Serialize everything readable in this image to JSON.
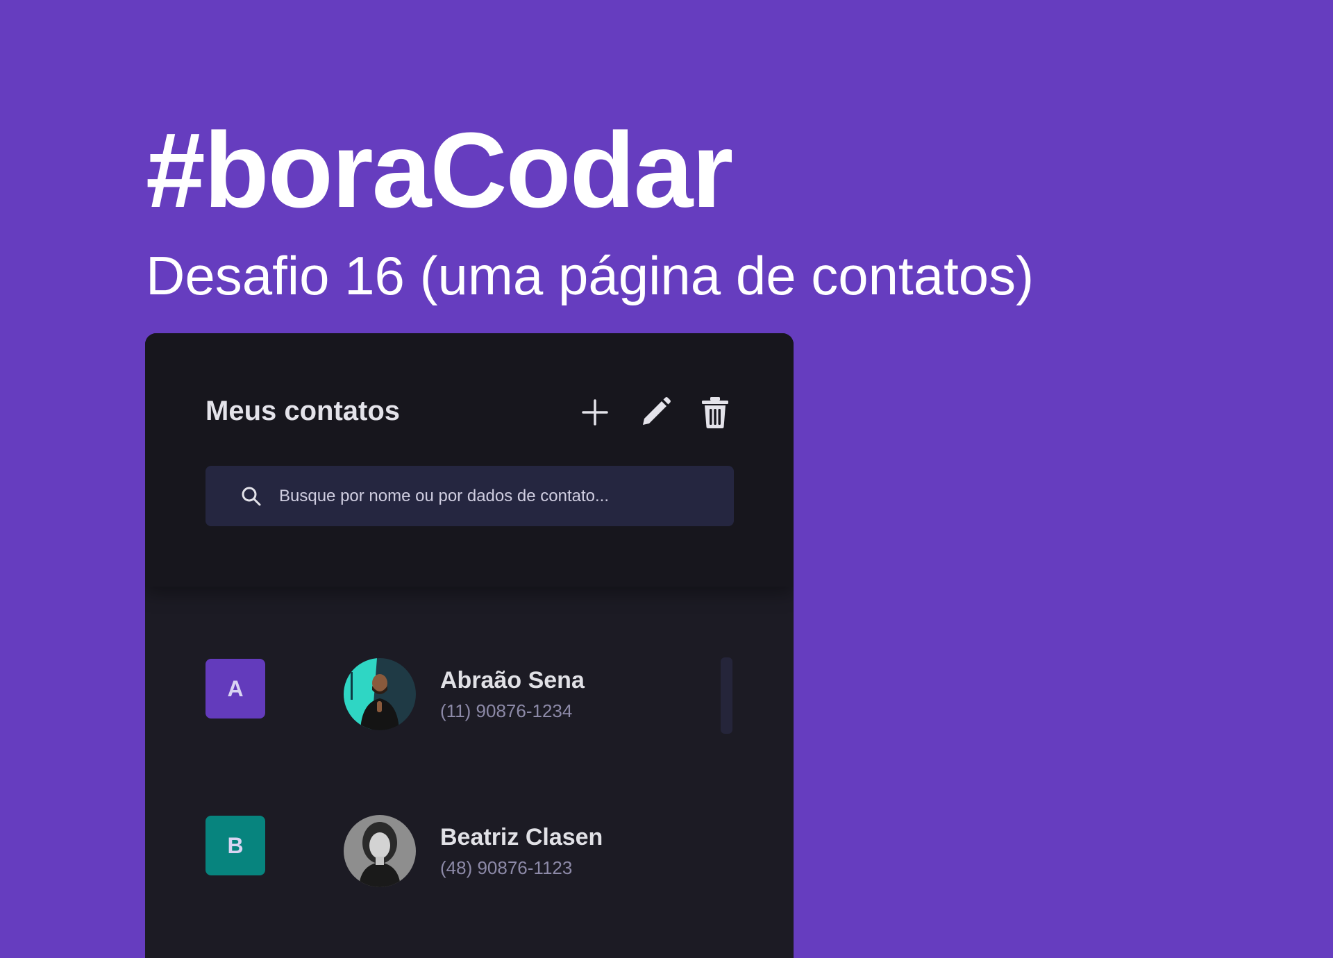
{
  "banner": {
    "headline": "#boraCodar",
    "subheadline": "Desafio 16 (uma página de contatos)"
  },
  "panel": {
    "title": "Meus contatos",
    "actions": [
      {
        "name": "add",
        "icon": "plus-icon"
      },
      {
        "name": "edit",
        "icon": "pencil-icon"
      },
      {
        "name": "delete",
        "icon": "trash-icon"
      }
    ],
    "search": {
      "icon": "search-icon",
      "placeholder": "Busque por nome ou por dados de contato..."
    },
    "contacts": [
      {
        "group": "A",
        "name": "Abraão Sena",
        "phone": "(11) 90876-1234",
        "avatar_icon": "avatar-photo",
        "group_color": "#633bbc"
      },
      {
        "group": "B",
        "name": "Beatriz Clasen",
        "phone": "(48) 90876-1123",
        "avatar_icon": "avatar-photo",
        "group_color": "#07847e"
      }
    ]
  },
  "colors": {
    "background": "#663dbf",
    "panel": "#1c1b24",
    "panel_header": "#17161d",
    "search": "#252640",
    "phone_text": "#8d8aa8"
  }
}
